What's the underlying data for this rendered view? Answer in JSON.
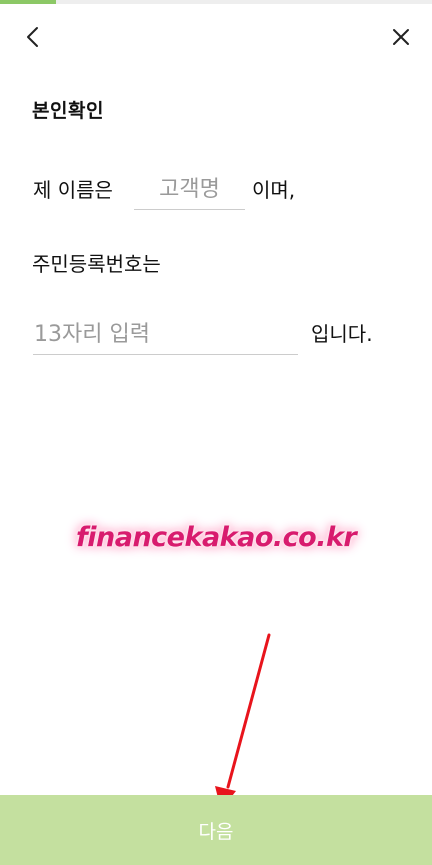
{
  "progress": {
    "fraction": 0.13,
    "fill_color": "#8cc866"
  },
  "header": {
    "back_icon": "chevron-left-icon",
    "close_icon": "close-icon"
  },
  "title": "본인확인",
  "name_line": {
    "prefix": "제 이름은",
    "placeholder": "고객명",
    "value": "",
    "suffix": "이며,"
  },
  "rrn_line": {
    "label": "주민등록번호는",
    "placeholder": "13자리 입력",
    "value": "",
    "suffix": "입니다."
  },
  "watermark": "financekakao.co.kr",
  "annotation": {
    "type": "arrow",
    "color": "#e8141c",
    "points_to": "next-button"
  },
  "next_button": {
    "label": "다음",
    "bg_color": "#c4e09f",
    "enabled": false
  }
}
